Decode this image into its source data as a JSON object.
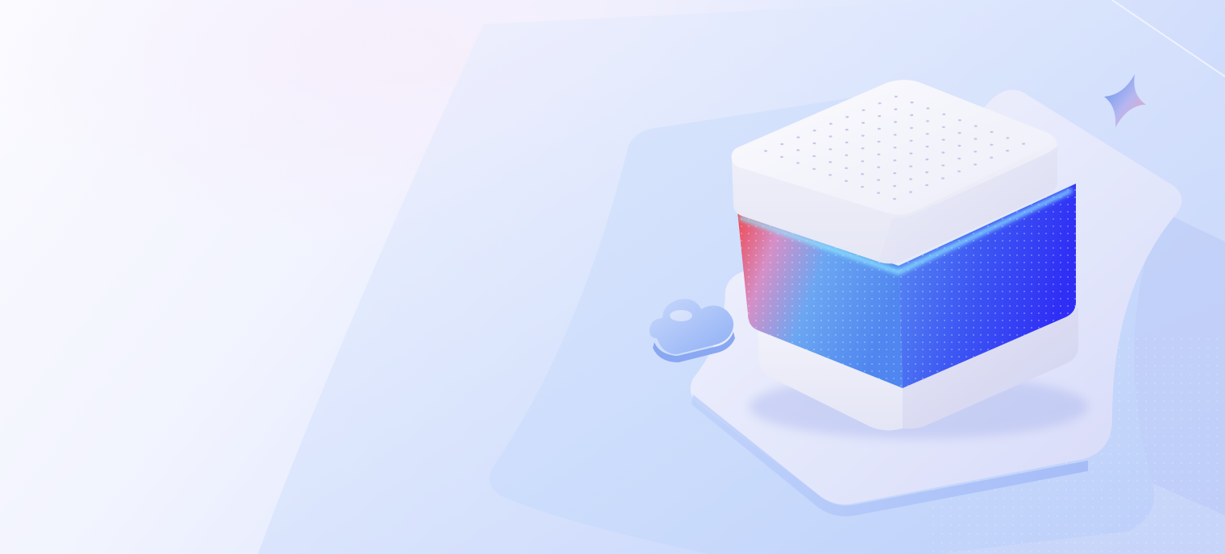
{
  "scene": {
    "description_visible_text": "",
    "colors": {
      "background_left": "#f8f8ff",
      "background_right": "#cfdcfb",
      "panel_tint": "#dbe5fd",
      "cube_top": "#f4f3fb",
      "band_red": "#f0474f",
      "band_light_blue": "#6ba6f2",
      "band_deep_blue": "#2f2ef5",
      "glow_cyan": "#8ee8ff",
      "cloud": "#a9c2f7",
      "sparkle_blue": "#5a8ff0",
      "sparkle_pink": "#f4a1b6"
    },
    "icons": [
      "cube-server-illustration",
      "cloud-icon",
      "sparkle-icon"
    ]
  }
}
